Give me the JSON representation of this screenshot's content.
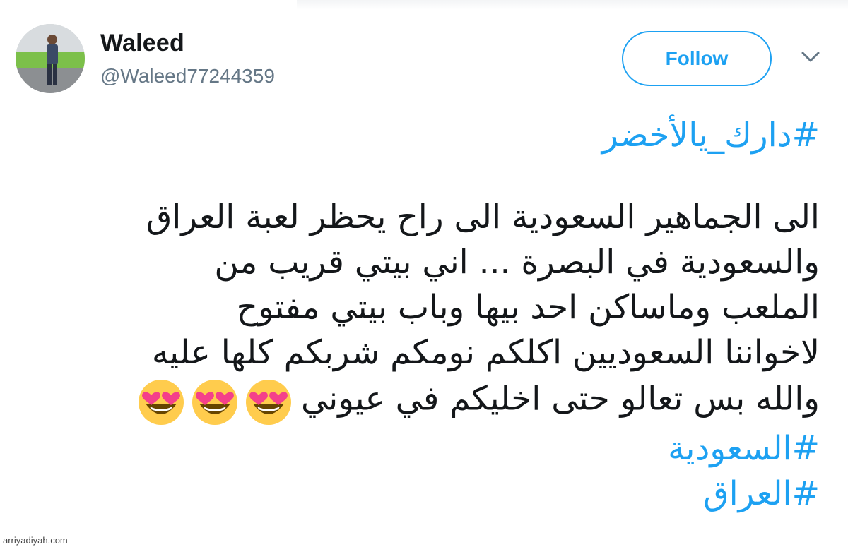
{
  "user": {
    "display_name": "Waleed",
    "handle": "@Waleed77244359"
  },
  "actions": {
    "follow_label": "Follow",
    "more_icon": "chevron-down-icon"
  },
  "tweet": {
    "hashtag_top": "#دارك_يالأخضر",
    "lines": [
      "الى الجماهير السعودية الى راح يحظر لعبة العراق",
      "والسعودية في البصرة ... اني بيتي قريب من",
      "الملعب وماساكن احد بيها وباب بيتي مفتوح",
      "لاخواننا السعوديين اكلكم نومكم شربكم كلها عليه",
      "والله بس تعالو حتى اخليكم في عيوني"
    ],
    "emoji": [
      "smiling-face-with-heart-eyes",
      "smiling-face-with-heart-eyes",
      "smiling-face-with-heart-eyes"
    ],
    "hashtags_bottom": [
      "#السعودية",
      "#العراق"
    ]
  },
  "watermark": "arriyadiyah.com",
  "colors": {
    "accent": "#1da1f2",
    "text": "#14171a",
    "secondary": "#657786"
  }
}
